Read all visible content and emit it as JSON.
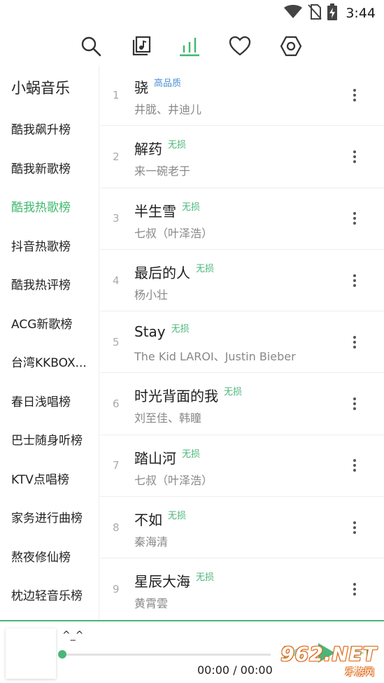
{
  "status_bar": {
    "time": "3:44",
    "icons": [
      "wifi-icon",
      "no-sim-icon",
      "battery-charging-icon"
    ]
  },
  "top_nav": {
    "tabs": [
      {
        "icon": "search-icon",
        "active": false
      },
      {
        "icon": "local-music-icon",
        "active": false
      },
      {
        "icon": "chart-icon",
        "active": true
      },
      {
        "icon": "heart-icon",
        "active": false
      },
      {
        "icon": "settings-icon",
        "active": false
      }
    ],
    "accent_color": "#3fb86f"
  },
  "sidebar": {
    "title": "小蜗音乐",
    "items": [
      {
        "label": "酷我飙升榜",
        "active": false
      },
      {
        "label": "酷我新歌榜",
        "active": false
      },
      {
        "label": "酷我热歌榜",
        "active": true
      },
      {
        "label": "抖音热歌榜",
        "active": false
      },
      {
        "label": "酷我热评榜",
        "active": false
      },
      {
        "label": "ACG新歌榜",
        "active": false
      },
      {
        "label": "台湾KKBOX...",
        "active": false
      },
      {
        "label": "春日浅唱榜",
        "active": false
      },
      {
        "label": "巴士随身听榜",
        "active": false
      },
      {
        "label": "KTV点唱榜",
        "active": false
      },
      {
        "label": "家务进行曲榜",
        "active": false
      },
      {
        "label": "熬夜修仙榜",
        "active": false
      },
      {
        "label": "枕边轻音乐榜",
        "active": false
      }
    ]
  },
  "songs": [
    {
      "num": "1",
      "title": "骁",
      "badge": "高品质",
      "artist": "井胧、井迪儿"
    },
    {
      "num": "2",
      "title": "解药",
      "badge": "无损",
      "artist": "来一碗老于"
    },
    {
      "num": "3",
      "title": "半生雪",
      "badge": "无损",
      "artist": "七叔（叶泽浩）"
    },
    {
      "num": "4",
      "title": "最后的人",
      "badge": "无损",
      "artist": "杨小壮"
    },
    {
      "num": "5",
      "title": "Stay",
      "badge": "无损",
      "artist": "The Kid LAROI、Justin Bieber"
    },
    {
      "num": "6",
      "title": "时光背面的我",
      "badge": "无损",
      "artist": "刘至佳、韩瞳"
    },
    {
      "num": "7",
      "title": "踏山河",
      "badge": "无损",
      "artist": "七叔（叶泽浩）"
    },
    {
      "num": "8",
      "title": "不如",
      "badge": "无损",
      "artist": "秦海清"
    },
    {
      "num": "9",
      "title": "星辰大海",
      "badge": "无损",
      "artist": "黄霄雲"
    }
  ],
  "player": {
    "title": "^_^",
    "time": "00:00 / 00:00",
    "progress": 0.0,
    "controls": [
      "previous-icon",
      "play-icon",
      "next-icon"
    ]
  },
  "watermark": {
    "big": "962.NET",
    "small": "乐游网"
  }
}
